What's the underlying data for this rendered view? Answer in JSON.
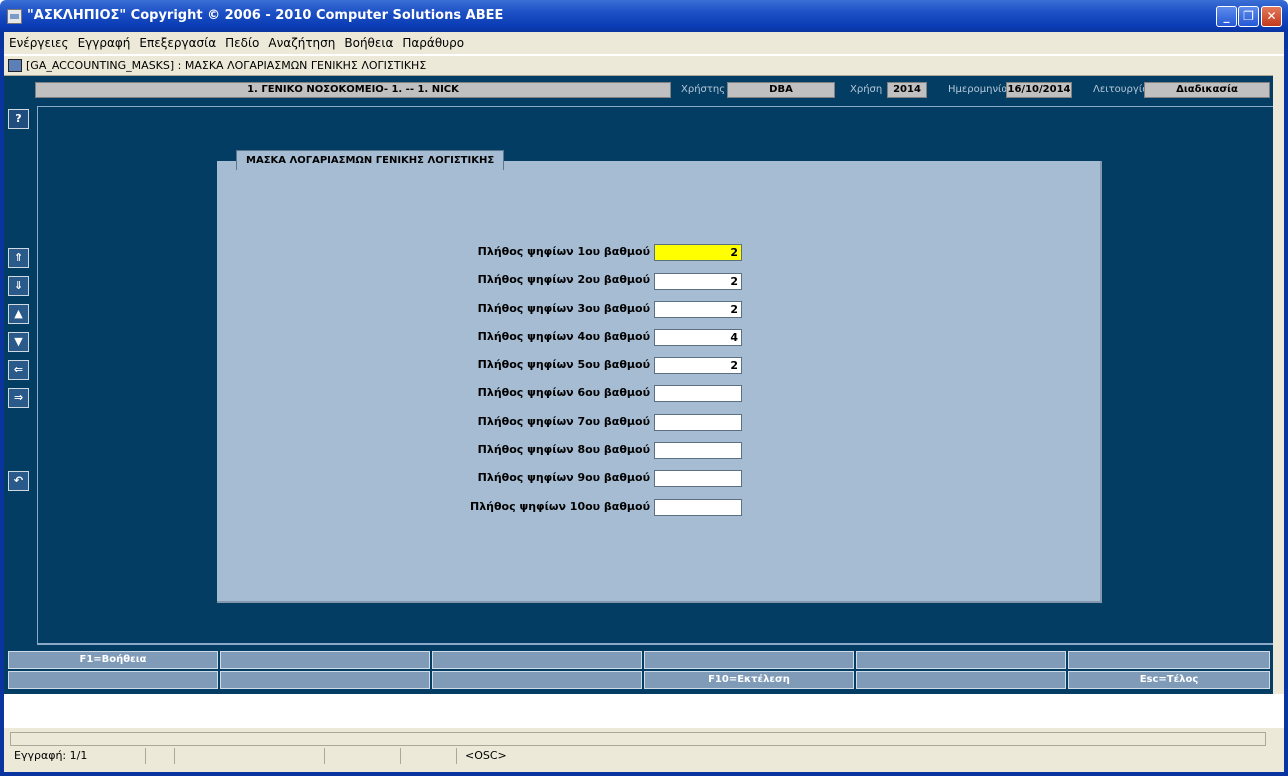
{
  "window": {
    "title": "\"ΑΣΚΛΗΠΙΟΣ\" Copyright © 2006 - 2010 Computer Solutions ΑΒΕΕ",
    "minimize": "_",
    "maximize": "❐",
    "close": "✕"
  },
  "menu": [
    "Ενέργειες",
    "Εγγραφή",
    "Επεξεργασία",
    "Πεδίο",
    "Αναζήτηση",
    "Βοήθεια",
    "Παράθυρο"
  ],
  "mdi": {
    "title": "[GA_ACCOUNTING_MASKS]  :  ΜΑΣΚΑ ΛΟΓΑΡΙΑΣΜΩΝ ΓΕΝΙΚΗΣ ΛΟΓΙΣΤΙΚΗΣ"
  },
  "header": {
    "organization": "1. ΓΕΝΙΚΟ ΝΟΣΟΚΟΜΕΙΟ- 1. -- 1. NICK",
    "user_label": "Χρήστης",
    "user_value": "DBA",
    "year_label": "Χρήση",
    "year_value": "2014",
    "date_label": "Ημερομηνία",
    "date_value": "16/10/2014",
    "function_label": "Λειτουργία",
    "function_value": "Διαδικασία"
  },
  "side_buttons": {
    "help": "?",
    "first": "⇑",
    "last": "⇓",
    "prev": "▲",
    "next": "▼",
    "left": "⇐",
    "right": "⇒",
    "undo": "↶"
  },
  "panel": {
    "title": "ΜΑΣΚΑ ΛΟΓΑΡΙΑΣΜΩΝ ΓΕΝΙΚΗΣ ΛΟΓΙΣΤΙΚΗΣ",
    "fields": [
      {
        "label": "Πλήθος ψηφίων 1ου βαθμού",
        "value": "2"
      },
      {
        "label": "Πλήθος ψηφίων 2ου βαθμού",
        "value": "2"
      },
      {
        "label": "Πλήθος ψηφίων 3ου βαθμού",
        "value": "2"
      },
      {
        "label": "Πλήθος ψηφίων 4ου βαθμού",
        "value": "4"
      },
      {
        "label": "Πλήθος ψηφίων 5ου βαθμού",
        "value": "2"
      },
      {
        "label": "Πλήθος ψηφίων 6ου βαθμού",
        "value": ""
      },
      {
        "label": "Πλήθος ψηφίων 7ου βαθμού",
        "value": ""
      },
      {
        "label": "Πλήθος ψηφίων 8ου βαθμού",
        "value": ""
      },
      {
        "label": "Πλήθος ψηφίων 9ου βαθμού",
        "value": ""
      },
      {
        "label": "Πλήθος ψηφίων 10ου βαθμού",
        "value": ""
      }
    ]
  },
  "function_keys": {
    "row1": [
      "F1=Βοήθεια",
      "",
      "",
      "",
      "",
      ""
    ],
    "row2": [
      "",
      "",
      "",
      "F10=Εκτέλεση",
      "",
      "Esc=Τέλος"
    ]
  },
  "status": {
    "record": "Εγγραφή: 1/1",
    "mode": "<OSC>"
  }
}
